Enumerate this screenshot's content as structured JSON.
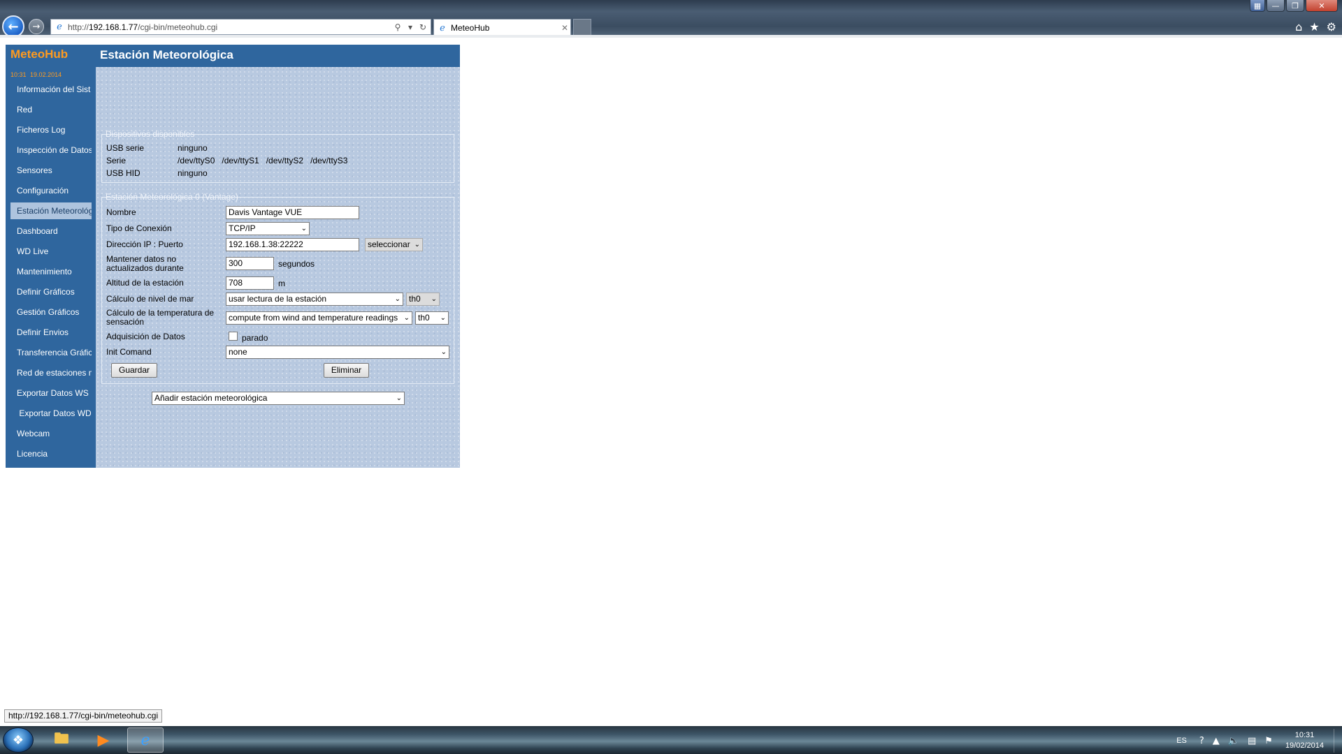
{
  "browser": {
    "url_prefix": "http://",
    "url_host": "192.168.1.77",
    "url_path": "/cgi-bin/meteohub.cgi",
    "tab_title": "MeteoHub",
    "status_url": "http://192.168.1.77/cgi-bin/meteohub.cgi",
    "icons": {
      "back": "back-arrow-icon",
      "forward": "forward-arrow-icon",
      "search": "search-icon",
      "refresh": "refresh-icon",
      "home": "home-icon",
      "favorites": "star-icon",
      "tools": "gear-icon",
      "close_tab": "close-icon"
    }
  },
  "sidebar": {
    "brand": "MeteoHub",
    "time": "10:31",
    "date": "19.02.2014",
    "items": [
      {
        "label": "Información del Sist"
      },
      {
        "label": "Red"
      },
      {
        "label": "Ficheros Log"
      },
      {
        "label": "Inspección de Datos"
      },
      {
        "label": "Sensores"
      },
      {
        "label": "Configuración"
      },
      {
        "label": "Estación Meteorológica",
        "active": true
      },
      {
        "label": "Dashboard"
      },
      {
        "label": "WD Live"
      },
      {
        "label": "Mantenimiento"
      },
      {
        "label": "Definir Gráficos"
      },
      {
        "label": "Gestión Gráficos"
      },
      {
        "label": "Definir Envios"
      },
      {
        "label": "Transferencia Gráficos"
      },
      {
        "label": "Red de estaciones meteorológicas"
      },
      {
        "label": "Exportar Datos WS"
      },
      {
        "label": " Exportar Datos WD"
      },
      {
        "label": "Webcam"
      },
      {
        "label": "Licencia"
      }
    ],
    "colors": {
      "background": "#2f669e",
      "brand": "#ff9b1f",
      "active_bg": "#aec4de"
    }
  },
  "main": {
    "title": "Estación Meteorológica",
    "devices": {
      "legend": "Dispositivos disponibles",
      "rows": [
        {
          "label": "USB serie",
          "value": "ninguno"
        },
        {
          "label": "Serie",
          "value": "/dev/ttyS0   /dev/ttyS1   /dev/ttyS2   /dev/ttyS3"
        },
        {
          "label": "USB HID",
          "value": "ninguno"
        }
      ]
    },
    "station": {
      "legend": "Estación Meteorológica 0 (Vantage)",
      "name_label": "Nombre",
      "name_value": "Davis Vantage VUE",
      "connection_label": "Tipo de Conexión",
      "connection_value": "TCP/IP",
      "ip_label": "Dirección IP : Puerto",
      "ip_value": "192.168.1.38:22222",
      "ip_select": "seleccionar",
      "keep_label_1": "Mantener datos no",
      "keep_label_2": "actualizados durante",
      "keep_value": "300",
      "keep_unit": "segundos",
      "altitude_label": "Altitud de la estación",
      "altitude_value": "708",
      "altitude_unit": "m",
      "sealevel_label": "Cálculo de nivel de mar",
      "sealevel_value": "usar lectura de la estación",
      "sealevel_sensor": "th0",
      "windchill_label_1": "Cálculo de la temperatura de",
      "windchill_label_2": "sensación",
      "windchill_value": "compute from wind and temperature readings",
      "windchill_sensor": "th0",
      "acq_label": "Adquisición de Datos",
      "acq_checkbox_label": "parado",
      "acq_checked": false,
      "init_label": "Init Comand",
      "init_value": "none",
      "save_label": "Guardar",
      "delete_label": "Eliminar"
    },
    "add_station": "Añadir estación meteorológica"
  },
  "taskbar": {
    "lang": "ES",
    "time": "10:31",
    "date": "19/02/2014",
    "apps": [
      "explorer-folder-icon",
      "media-player-icon",
      "internet-explorer-icon"
    ]
  }
}
